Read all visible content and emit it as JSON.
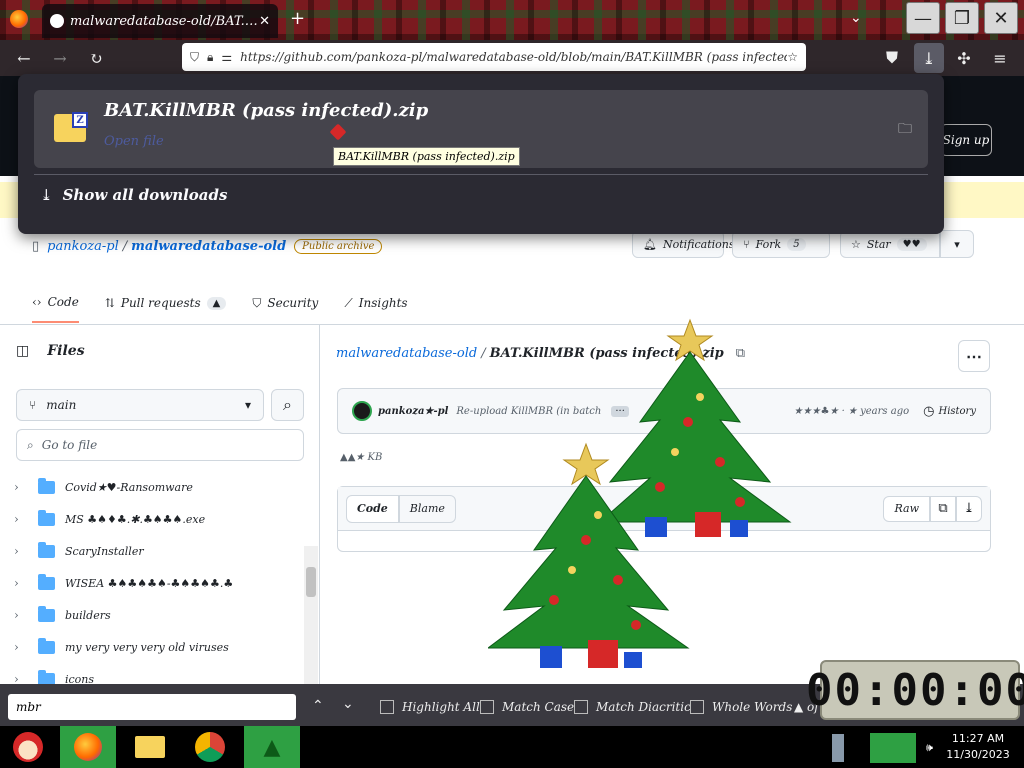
{
  "browser": {
    "tab_title": "malwaredatabase-old/BAT.KillMBR",
    "url": "https://github.com/pankoza-pl/malwaredatabase-old/blob/main/BAT.KillMBR (pass infected).zip",
    "icons": [
      "back-icon",
      "forward-icon",
      "reload-icon",
      "shield-icon",
      "lock-icon",
      "permissions-icon",
      "bookmark-star-icon",
      "pocket-icon",
      "downloads-icon",
      "extensions-icon",
      "menu-icon"
    ]
  },
  "downloads": {
    "filename": "BAT.KillMBR (pass infected).zip",
    "status": "Open file",
    "show_all": "Show all downloads",
    "tooltip": "BAT.KillMBR (pass infected).zip",
    "zip_letter": "Z"
  },
  "header": {
    "signup": "Sign up"
  },
  "repo": {
    "owner": "pankoza-pl",
    "separator": "/",
    "name": "malwaredatabase-old",
    "visibility": "Public archive",
    "notifications": "Notifications",
    "fork_label": "Fork",
    "fork_count": "5",
    "star_label": "Star",
    "star_count": "♥♥"
  },
  "tabs": [
    {
      "label": "Code",
      "badge": ""
    },
    {
      "label": "Pull requests",
      "badge": "▲"
    },
    {
      "label": "Security",
      "badge": ""
    },
    {
      "label": "Insights",
      "badge": ""
    }
  ],
  "sidebar": {
    "title": "Files",
    "branch": "main",
    "filter_placeholder": "Go to file",
    "items": [
      "Covid★♥-Ransomware",
      "MS ♣♠♦♣.✱.♣♠♣♠.exe",
      "ScaryInstaller",
      "WISEA ♣♠♣♠♣♠-♣♠♣♠♣.♣",
      "builders",
      "my very very very old viruses",
      "icons"
    ]
  },
  "main": {
    "crumb_repo": "malwaredatabase-old",
    "crumb_sep": "/",
    "crumb_file": "BAT.KillMBR (pass infected).zip",
    "commit_author": "pankoza★-pl",
    "commit_message": "Re-upload KillMBR (in batch",
    "commit_time": "★★★♣★ · ★ years ago",
    "history": "History",
    "file_size": "▲▲★ KB",
    "code_tab": "Code",
    "blame_tab": "Blame",
    "raw": "Raw"
  },
  "findbar": {
    "query": "mbr",
    "highlight_all": "Highlight All",
    "match_case": "Match Case",
    "match_diacritics": "Match Diacritics",
    "whole_words": "Whole Words",
    "result": "▲ of"
  },
  "clock_widget": "00:00:00",
  "taskbar": {
    "time": "11:27 AM",
    "date": "11/30/2023"
  }
}
